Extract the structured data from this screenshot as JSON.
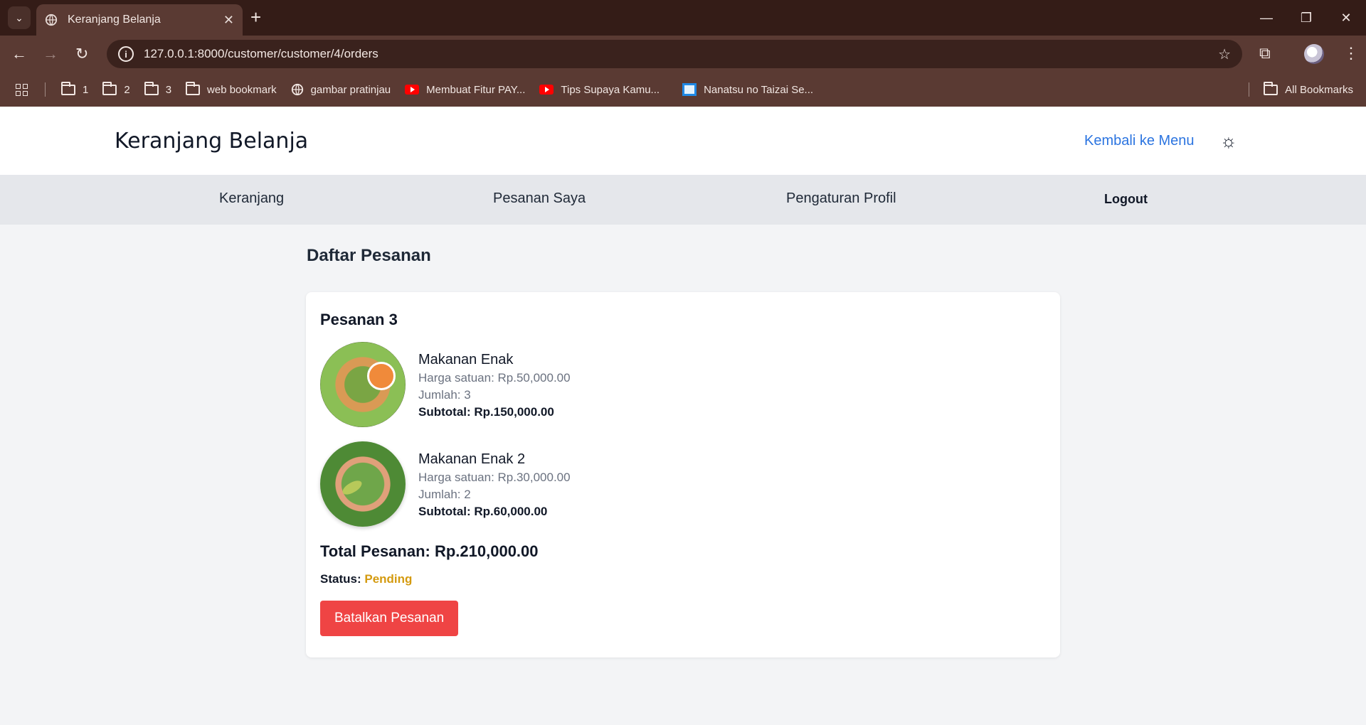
{
  "browser": {
    "tab_title": "Keranjang Belanja",
    "url": "127.0.0.1:8000/customer/customer/4/orders",
    "bookmarks": [
      {
        "label": "1",
        "icon": "folder-icon"
      },
      {
        "label": "2",
        "icon": "folder-icon"
      },
      {
        "label": "3",
        "icon": "folder-icon"
      },
      {
        "label": "web bookmark",
        "icon": "folder-icon"
      },
      {
        "label": "gambar pratinjau",
        "icon": "globe-icon"
      },
      {
        "label": "Membuat Fitur PAY...",
        "icon": "youtube-icon"
      },
      {
        "label": "Tips Supaya Kamu...",
        "icon": "youtube-icon"
      },
      {
        "label": "Nanatsu no Taizai Se...",
        "icon": "site-icon"
      }
    ],
    "all_bookmarks": "All Bookmarks"
  },
  "header": {
    "brand": "Keranjang Belanja",
    "back_link": "Kembali ke Menu"
  },
  "subnav": {
    "cart": "Keranjang",
    "orders": "Pesanan Saya",
    "profile": "Pengaturan Profil",
    "logout": "Logout"
  },
  "main": {
    "heading": "Daftar Pesanan",
    "order": {
      "title": "Pesanan 3",
      "items": [
        {
          "name": "Makanan Enak",
          "price": "Harga satuan: Rp.50,000.00",
          "qty": "Jumlah: 3",
          "subtotal": "Subtotal: Rp.150,000.00"
        },
        {
          "name": "Makanan Enak 2",
          "price": "Harga satuan: Rp.30,000.00",
          "qty": "Jumlah: 2",
          "subtotal": "Subtotal: Rp.60,000.00"
        }
      ],
      "total": "Total Pesanan: Rp.210,000.00",
      "status_label": "Status:",
      "status_value": "Pending",
      "cancel_button": "Batalkan Pesanan"
    }
  },
  "colors": {
    "browser_frame": "#341c17",
    "link": "#2b74e0",
    "status_pending": "#d49a0f",
    "danger": "#ef4444"
  }
}
